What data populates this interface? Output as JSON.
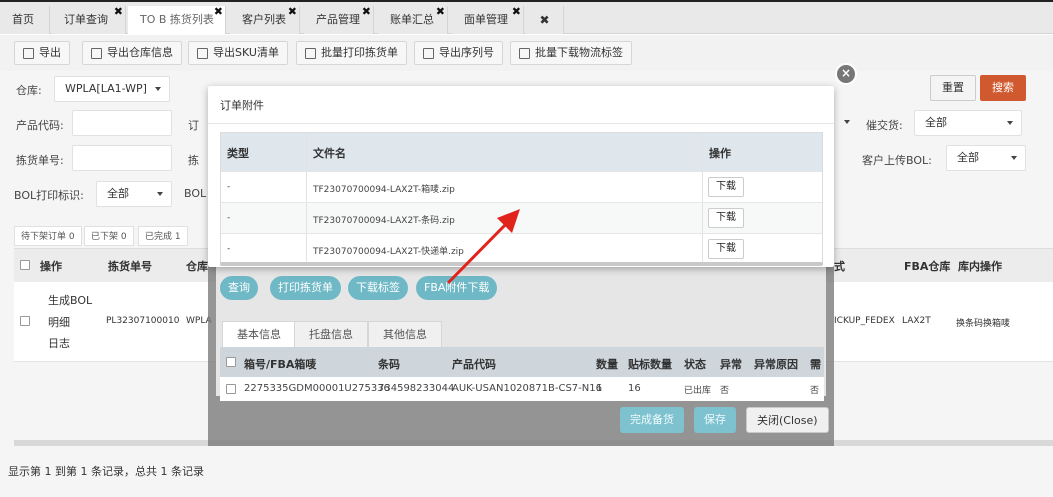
{
  "tabs": [
    {
      "label": "首页",
      "close": ""
    },
    {
      "label": "订单查询",
      "close": "✖"
    },
    {
      "label": "TO B 拣货列表",
      "close": "✖"
    },
    {
      "label": "客户列表",
      "close": "✖"
    },
    {
      "label": "产品管理",
      "close": "✖"
    },
    {
      "label": "账单汇总",
      "close": "✖"
    },
    {
      "label": "面单管理",
      "close": "✖"
    }
  ],
  "close_all": "✖",
  "toolbar": [
    {
      "label": "导出",
      "icon": "export-icon"
    },
    {
      "label": "导出仓库信息",
      "icon": "export-icon"
    },
    {
      "label": "导出SKU清单",
      "icon": "export-icon"
    },
    {
      "label": "批量打印拣货单",
      "icon": "print-icon"
    },
    {
      "label": "导出序列号",
      "icon": "export-icon"
    },
    {
      "label": "批量下载物流标签",
      "icon": "download-icon"
    }
  ],
  "filters": {
    "warehouse_label": "仓库:",
    "warehouse_value": "WPLA[LA1-WP]",
    "product_code_label": "产品代码:",
    "pick_no_label": "拣货单号:",
    "bol_print_label": "BOL打印标识:",
    "bol_print_value": "全部",
    "ding_label": "订",
    "jian_label": "拣",
    "bol_label": "BOL",
    "urge_label": "催交货:",
    "urge_value": "全部",
    "customer_bol_label": "客户上传BOL:",
    "customer_bol_value": "全部",
    "reset": "重置",
    "search": "搜索"
  },
  "subtabs": [
    "待下架订单 0",
    "已下架 0",
    "已完成 1"
  ],
  "grid": {
    "headers": [
      "操作",
      "拣货单号",
      "仓库",
      "式",
      "FBA仓库",
      "库内操作"
    ],
    "row": {
      "ops": [
        "生成BOL",
        "明细",
        "日志"
      ],
      "pick_no": "PL32307100010",
      "warehouse": "WPLA",
      "method": "ICKUP_FEDEX",
      "fba": "LAX2T",
      "inner_op": "换条码换箱唛"
    }
  },
  "footer": "显示第 1 到第 1 条记录，总共 1 条记录",
  "detail": {
    "buttons": [
      "查询",
      "打印拣货单",
      "下载标签",
      "FBA附件下载"
    ],
    "tabs": [
      "基本信息",
      "托盘信息",
      "其他信息"
    ],
    "headers": [
      "箱号/FBA箱唛",
      "条码",
      "产品代码",
      "数量",
      "贴标数量",
      "状态",
      "异常",
      "异常原因",
      "需"
    ],
    "row": {
      "box": "2275335GDM00001U275336",
      "barcode": "734598233044",
      "product": "AUK-USAN1020871B-CS7-N16",
      "qty": "1",
      "label_qty": "16",
      "status": "已出库",
      "abnormal": "否",
      "extra": "否"
    },
    "complete": "完成备货",
    "save": "保存",
    "close": "关闭(Close)"
  },
  "attach_dialog": {
    "title": "订单附件",
    "headers": {
      "type": "类型",
      "filename": "文件名",
      "action": "操作"
    },
    "rows": [
      {
        "type": "-",
        "filename": "TF23070700094-LAX2T-箱唛.zip",
        "action": "下载"
      },
      {
        "type": "-",
        "filename": "TF23070700094-LAX2T-条码.zip",
        "action": "下载"
      },
      {
        "type": "-",
        "filename": "TF23070700094-LAX2T-快递单.zip",
        "action": "下载"
      }
    ]
  },
  "colors": {
    "accent": "#d0592f",
    "teal": "#6fb8c6",
    "arrow": "#e0241c"
  }
}
